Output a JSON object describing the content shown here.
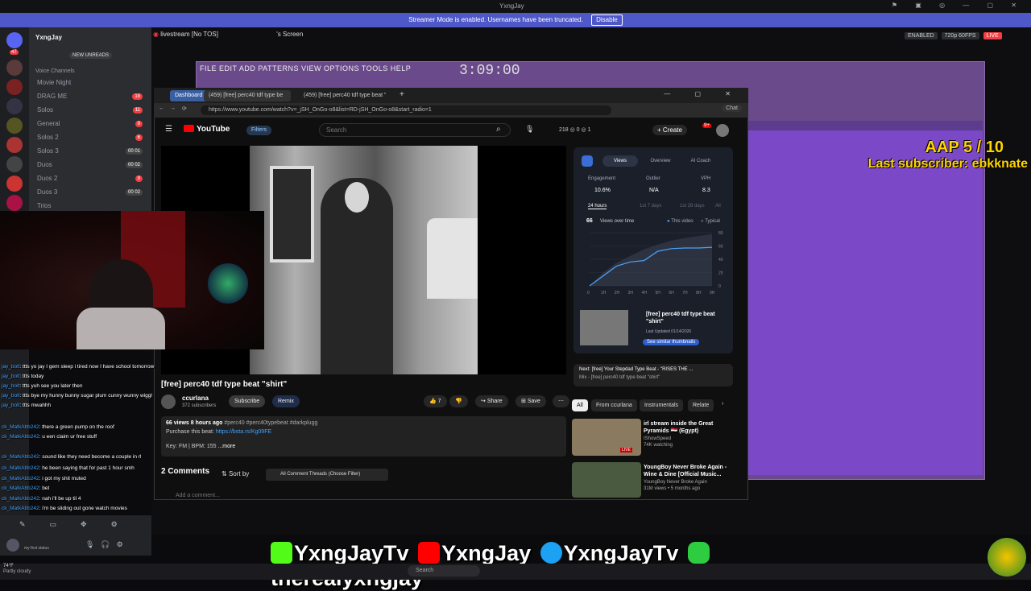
{
  "window": {
    "title": "YxngJay"
  },
  "streamer_mode": {
    "message": "Streamer Mode is enabled. Usernames have been truncated.",
    "disable_label": "Disable"
  },
  "discord": {
    "server_name": "YxngJay",
    "new_unreads": "NEW UNREADS",
    "voice_channels_label": "Voice Channels",
    "channels": [
      {
        "name": "Movie Night",
        "badge": ""
      },
      {
        "name": "DRAG ME",
        "badge": "18"
      },
      {
        "name": "Solos",
        "badge": "11"
      },
      {
        "name": "General",
        "badge": "9"
      },
      {
        "name": "Solos 2",
        "badge": "6"
      },
      {
        "name": "Solos 3",
        "badge": "00 01"
      },
      {
        "name": "Duos",
        "badge": "00 02"
      },
      {
        "name": "Duos 2",
        "badge": "9"
      },
      {
        "name": "Duos 3",
        "badge": "00 02"
      },
      {
        "name": "Trios",
        "badge": ""
      }
    ],
    "stream_header": "livestream [No TOS]",
    "screen_label": "'s Screen",
    "enabled_label": "ENABLED",
    "quality": "720p 60FPS",
    "live": "LIVE",
    "user_status": "my first status",
    "notification_count": "47"
  },
  "fl_studio": {
    "menu": "FILE EDIT ADD PATTERNS VIEW OPTIONS TOOLS HELP",
    "time": "3:09:00"
  },
  "overlay": {
    "aap_count": "AAP 5 / 10",
    "last_subscriber": "Last subscriber: ebkknate"
  },
  "browser": {
    "tabs": [
      {
        "label": "Dashboard"
      },
      {
        "label": "(459) [free] perc40 tdf type be"
      },
      {
        "label": "(459) [free] perc40 tdf type beat \"s"
      }
    ],
    "new_tab": "+",
    "url": "https://www.youtube.com/watch?v=_jSH_OnGo-o8&list=RD-jSH_OnGo-o8&start_radio=1",
    "chat_label": "Chat"
  },
  "youtube": {
    "logo": "YouTube",
    "filters": "Filters",
    "search_placeholder": "Search",
    "stats": "218 ◎ 0 ◎ 1",
    "create": "Create",
    "notif_badge": "9+",
    "video_title": "[free] perc40 tdf type beat \"shirt\"",
    "channel": "ccurlana",
    "subscribers": "372 subscribers",
    "subscribe": "Subscribe",
    "remix": "Remix",
    "likes": "7",
    "share": "Share",
    "save": "Save",
    "views_line": "66 views  8 hours ago",
    "tags": "#perc40 #perc40typebeat #darkplugg",
    "purchase": "Purchase this beat:",
    "purchase_link": "https://bsta.rs/Kg09FE",
    "key_line": "Key: FM | BPM: 155",
    "more": "...more",
    "comments_count": "2 Comments",
    "sort_by": "Sort by",
    "all_threads": "All Comment Threads (Choose Filter)",
    "add_comment": "Add a comment..."
  },
  "vidiq": {
    "tabs": [
      "Views",
      "Overview",
      "AI Coach"
    ],
    "metrics": [
      {
        "label": "Engagement",
        "value": "10.6%"
      },
      {
        "label": "Outlier",
        "value": "N/A"
      },
      {
        "label": "VPH",
        "value": "8.3"
      }
    ],
    "ranges": [
      "24 hours",
      "1st 7 days",
      "1st 28 days",
      "All"
    ],
    "views_total": "66",
    "views_over_time": "Views over time",
    "legend_this": "This video",
    "legend_typical": "Typical",
    "thumb_title": "[free] perc40 tdf type beat \"shirt\"",
    "last_updated": "Last Updated 01/14/2026",
    "similar_button": "See similar thumbnails"
  },
  "chart_data": {
    "type": "line",
    "x": [
      "0",
      "1H",
      "2H",
      "3H",
      "4H",
      "5H",
      "6H",
      "7H",
      "8H",
      "9H"
    ],
    "series": [
      {
        "name": "This video",
        "values": [
          0,
          15,
          30,
          36,
          38,
          52,
          56,
          57,
          57,
          58
        ]
      },
      {
        "name": "Typical",
        "values": [
          0,
          20,
          35,
          45,
          55,
          62,
          68,
          72,
          75,
          78
        ]
      }
    ],
    "yticks": [
      "0",
      "20",
      "40",
      "60",
      "80"
    ],
    "ylim": [
      0,
      80
    ]
  },
  "up_next": {
    "title": "Next: [free] Your Stepdad Type Beat - \"RISES THE ...",
    "subtitle": "Mix - [free] perc40 tdf type beat \"shirt\""
  },
  "chips": [
    "All",
    "From ccurlana",
    "Instrumentals",
    "Relate"
  ],
  "recommendations": [
    {
      "title": "irl stream inside the Great Pyramids 🇪🇬 (Egypt)",
      "channel": "IShowSpeed",
      "meta": "74K watching",
      "badge": "LIVE"
    },
    {
      "title": "YoungBoy Never Broke Again - Wine & Dine [Official Music...",
      "channel": "YoungBoy Never Broke Again",
      "meta": "31M views • 5 months ago",
      "badge": ""
    }
  ],
  "chat": [
    {
      "user": "jay_bolt",
      "msg": ": ttts yo jay I gem sleep i tired now I have school tomorrow"
    },
    {
      "user": "jay_bolt",
      "msg": ": ttts today"
    },
    {
      "user": "jay_bolt",
      "msg": ": ttts yuh see you later then"
    },
    {
      "user": "jay_bolt",
      "msg": ": ttts bye my hunny bunny sugar plum cunny wunny wiggl"
    },
    {
      "user": "jay_bolt",
      "msg": ": ttts mwahhh"
    },
    {
      "user": "ck_MatkAbb242",
      "msg": ": there a green pump on the roof"
    },
    {
      "user": "ck_MatkAbb242",
      "msg": ": u een claim ur free stuff"
    },
    {
      "user": "ck_MatkAbb242",
      "msg": ": sound like they need become a couple in rl"
    },
    {
      "user": "ck_MatkAbb242",
      "msg": ": he been saying that for past 1 hour smh"
    },
    {
      "user": "ck_MatkAbb242",
      "msg": ": i got my shit muted"
    },
    {
      "user": "ck_MatkAbb242",
      "msg": ": bet"
    },
    {
      "user": "ck_MatkAbb242",
      "msg": ": nah i'll be up til 4"
    },
    {
      "user": "ck_MatkAbb242",
      "msg": ": i'm be sliding out gone watch movies"
    }
  ],
  "socials": [
    {
      "platform": "kick",
      "handle": "YxngJayTv",
      "color": "#53fc18"
    },
    {
      "platform": "youtube",
      "handle": "YxngJay",
      "color": "#ff0000"
    },
    {
      "platform": "twitter",
      "handle": "YxngJayTv",
      "color": "#1da1f2"
    },
    {
      "platform": "instagram",
      "handle": "therealyxngjay",
      "color": "#2ecc40"
    }
  ],
  "taskbar": {
    "search": "Search",
    "weather_temp": "74°F",
    "weather_desc": "Partly cloudy"
  }
}
